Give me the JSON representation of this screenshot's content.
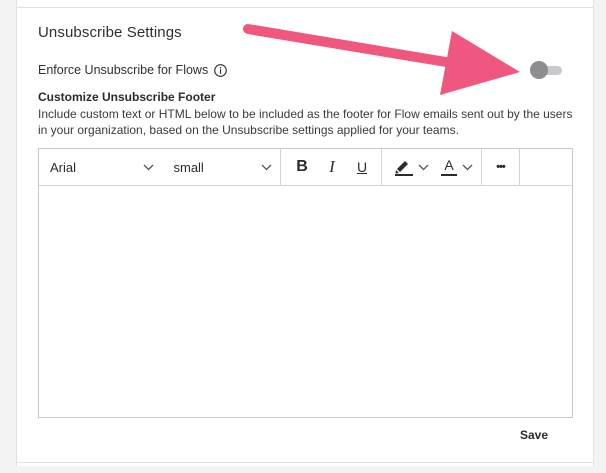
{
  "section": {
    "title": "Unsubscribe Settings"
  },
  "enforce": {
    "label": "Enforce Unsubscribe for Flows",
    "enabled": false,
    "info_icon": "info-icon"
  },
  "footer": {
    "title": "Customize Unsubscribe Footer",
    "description": "Include custom text or HTML below to be included as the footer for Flow emails sent out by the users in your organization, based on the Unsubscribe settings applied for your teams."
  },
  "editor": {
    "font_family": "Arial",
    "font_size": "small",
    "bold_label": "B",
    "italic_label": "I",
    "underline_label": "U",
    "highlight_icon": "highlighter-icon",
    "text_color_label": "A",
    "more_label": "•••",
    "content": ""
  },
  "actions": {
    "save_label": "Save"
  },
  "colors": {
    "annotation_arrow": "#f0577e",
    "toggle_knob": "#8d8d91",
    "toggle_track": "#c9c9cd"
  }
}
